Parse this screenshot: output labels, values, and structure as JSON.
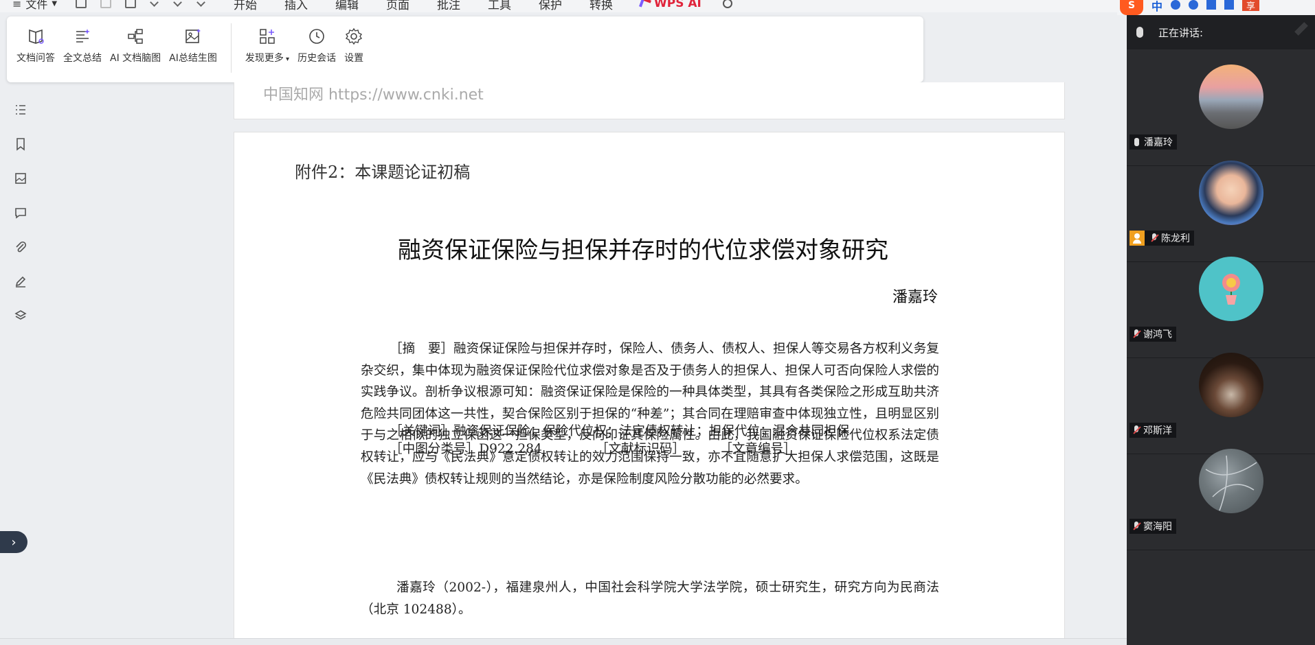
{
  "menubar": {
    "file_label": "文件",
    "tabs": [
      "开始",
      "插入",
      "编辑",
      "页面",
      "批注",
      "工具",
      "保护",
      "转换"
    ],
    "ai_tab": "WPS AI"
  },
  "tray": {
    "sogou": "S",
    "ime": "中",
    "share": "享"
  },
  "ai_toolbar": {
    "items": [
      {
        "label": "文档问答",
        "icon": "doc-qa-icon"
      },
      {
        "label": "全文总结",
        "icon": "summary-icon"
      },
      {
        "label": "AI 文档脑图",
        "icon": "mindmap-icon"
      },
      {
        "label": "AI总结生图",
        "icon": "image-gen-icon"
      },
      {
        "label": "发现更多",
        "icon": "discover-icon"
      },
      {
        "label": "历史会话",
        "icon": "history-icon"
      },
      {
        "label": "设置",
        "icon": "gear-icon"
      }
    ]
  },
  "document": {
    "prev_page_footer": "中国知网    https://www.cnki.net",
    "attachment": "附件2：本课题论证初稿",
    "title": "融资保证保险与担保并存时的代位求偿对象研究",
    "author": "潘嘉玲",
    "abstract_label": "［摘　要］",
    "abstract": "融资保证保险与担保并存时，保险人、债务人、债权人、担保人等交易各方权利义务复杂交织，集中体现为融资保证保险代位求偿对象是否及于债务人的担保人、担保人可否向保险人求偿的实践争议。剖析争议根源可知：融资保证保险是保险的一种具体类型，其具有各类保险之形成互助共济危险共同团体这一共性，契合保险区别于担保的“种差”；其合同在理赔审查中体现独立性，且明显区别于与之相似的独立保函这一担保类型，反向印证其保险属性。由此，我国融资保证保险代位权系法定债权转让，应与《民法典》意定债权转让的效力范围保持一致，亦不宜随意扩大担保人求偿范围，这既是《民法典》债权转让规则的当然结论，亦是保险制度风险分散功能的必然要求。",
    "keywords_label": "［关键词］",
    "keywords": "融资保证保险；保险代位权；法定债权转让；担保代位；混合共同担保",
    "clc_label": "［中图分类号］",
    "clc": "D922.284",
    "doc_code_label": "［文献标识码］",
    "article_no_label": "［文章编号］",
    "author_note": "潘嘉玲（2002-），福建泉州人，中国社会科学院大学法学院，硕士研究生，研究方向为民商法（北京 102488）。"
  },
  "meeting": {
    "speaking_label": "正在讲话:",
    "participants": [
      {
        "name": "潘嘉玲",
        "muted": false,
        "host": false,
        "avatar": "city-sunset"
      },
      {
        "name": "陈龙利",
        "muted": true,
        "host": true,
        "avatar": "smiling-person"
      },
      {
        "name": "谢鸿飞",
        "muted": true,
        "host": false,
        "avatar": "flower-cartoon"
      },
      {
        "name": "邓斯洋",
        "muted": true,
        "host": false,
        "avatar": "dark-portrait"
      },
      {
        "name": "窦海阳",
        "muted": true,
        "host": false,
        "avatar": "map-aerial"
      }
    ]
  },
  "colors": {
    "accent_red": "#e0233a",
    "meeting_bg": "#2b2c2f",
    "host_badge": "#f0a020"
  }
}
